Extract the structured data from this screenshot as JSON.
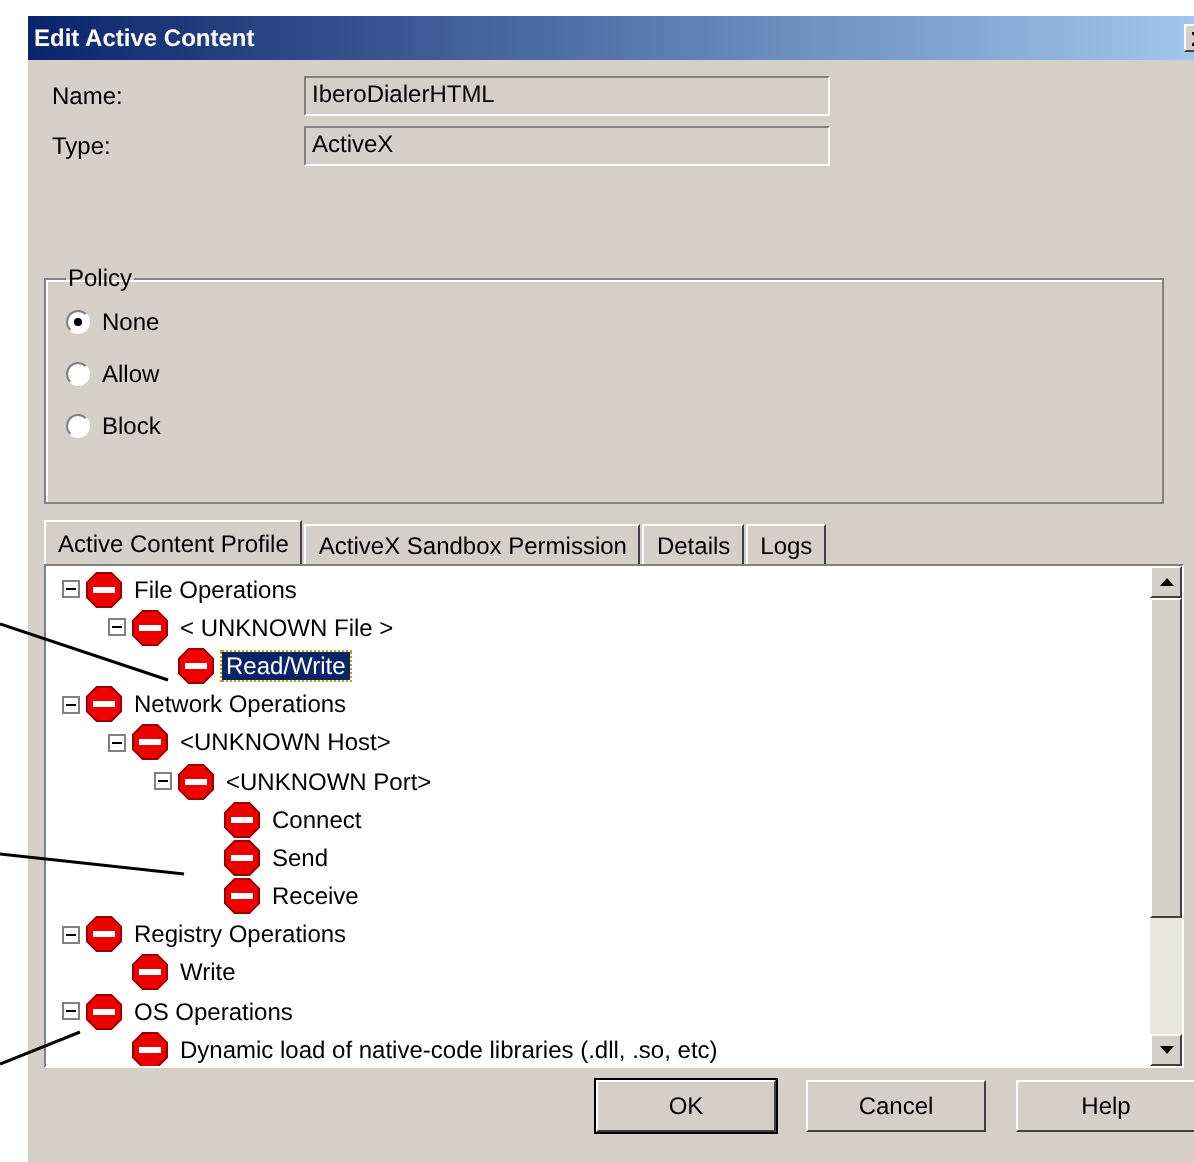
{
  "window": {
    "title": "Edit Active Content"
  },
  "fields": [
    {
      "label": "Name:",
      "value": "IberoDialerHTML"
    },
    {
      "label": "Type:",
      "value": "ActiveX"
    }
  ],
  "policy": {
    "title": "Policy",
    "options": [
      {
        "label": "None",
        "selected": true
      },
      {
        "label": "Allow",
        "selected": false
      },
      {
        "label": "Block",
        "selected": false
      }
    ]
  },
  "tabs": [
    {
      "label": "Active Content Profile",
      "selected": true
    },
    {
      "label": "ActiveX  Sandbox Permission",
      "selected": false
    },
    {
      "label": "Details",
      "selected": false
    },
    {
      "label": "Logs",
      "selected": false
    }
  ],
  "tree": [
    {
      "label": "File Operations",
      "expanded": true,
      "selected": false,
      "children": [
        {
          "label": "< UNKNOWN File >",
          "expanded": true,
          "selected": false,
          "children": [
            {
              "label": "Read/Write",
              "selected": true
            }
          ]
        }
      ]
    },
    {
      "label": "Network Operations",
      "expanded": true,
      "selected": false,
      "children": [
        {
          "label": "<UNKNOWN Host>",
          "expanded": true,
          "selected": false,
          "children": [
            {
              "label": "<UNKNOWN Port>",
              "expanded": true,
              "selected": false,
              "children": [
                {
                  "label": "Connect",
                  "selected": false
                },
                {
                  "label": "Send",
                  "selected": false
                },
                {
                  "label": "Receive",
                  "selected": false
                }
              ]
            }
          ]
        }
      ]
    },
    {
      "label": "Registry Operations",
      "expanded": true,
      "selected": false,
      "children": [
        {
          "label": "Write",
          "selected": false
        }
      ]
    },
    {
      "label": "OS Operations",
      "expanded": true,
      "selected": false,
      "children": [
        {
          "label": "Dynamic load of native-code libraries (.dll, .so, etc)",
          "selected": false
        }
      ]
    }
  ],
  "buttons": [
    {
      "label": "OK",
      "kind": "default"
    },
    {
      "label": "Cancel",
      "kind": "normal"
    },
    {
      "label": "Help",
      "kind": "normal"
    }
  ]
}
